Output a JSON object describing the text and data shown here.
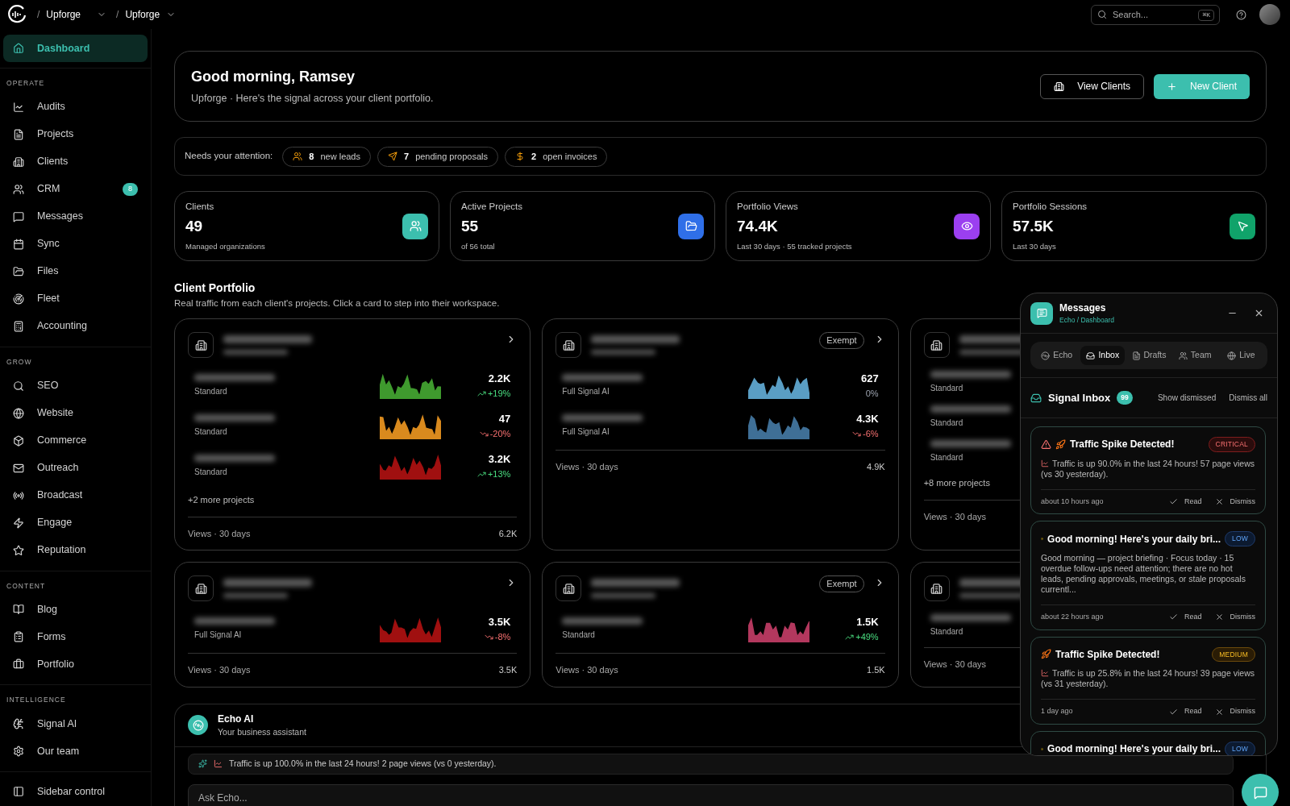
{
  "topbar": {
    "breadcrumbs": [
      {
        "separator": "/",
        "label": "Upforge"
      },
      {
        "separator": "/",
        "label": "Upforge"
      }
    ],
    "search": {
      "placeholder": "Search...",
      "shortcut": "⌘K"
    }
  },
  "sidebar": {
    "home": {
      "label": "Dashboard",
      "selected": true
    },
    "sections": [
      {
        "title": "OPERATE",
        "items": [
          {
            "label": "Audits",
            "selected": false
          },
          {
            "label": "Projects",
            "selected": false
          },
          {
            "label": "Clients",
            "selected": false
          },
          {
            "label": "CRM",
            "selected": false,
            "badge": "8"
          },
          {
            "label": "Messages",
            "selected": false
          },
          {
            "label": "Sync",
            "selected": false
          },
          {
            "label": "Files",
            "selected": false
          },
          {
            "label": "Fleet",
            "selected": false
          },
          {
            "label": "Accounting",
            "selected": false
          }
        ]
      },
      {
        "title": "GROW",
        "items": [
          {
            "label": "SEO",
            "selected": false
          },
          {
            "label": "Website",
            "selected": false
          },
          {
            "label": "Commerce",
            "selected": false
          },
          {
            "label": "Outreach",
            "selected": false
          },
          {
            "label": "Broadcast",
            "selected": false
          },
          {
            "label": "Engage",
            "selected": false
          },
          {
            "label": "Reputation",
            "selected": false
          }
        ]
      },
      {
        "title": "CONTENT",
        "items": [
          {
            "label": "Blog",
            "selected": false
          },
          {
            "label": "Forms",
            "selected": false
          },
          {
            "label": "Portfolio",
            "selected": false
          }
        ]
      },
      {
        "title": "INTELLIGENCE",
        "items": [
          {
            "label": "Signal AI",
            "selected": false
          },
          {
            "label": "Our team",
            "selected": false
          }
        ]
      }
    ],
    "footer": {
      "label": "Sidebar control"
    }
  },
  "header": {
    "title": "Good morning, Ramsey",
    "subtitle": "Upforge · Here's the signal across your client portfolio.",
    "buttons": [
      {
        "label": "View Clients",
        "kind": "secondary"
      },
      {
        "label": "New Client",
        "kind": "primary"
      }
    ]
  },
  "attention": {
    "label": "Needs your attention:",
    "chips": [
      {
        "count": "8",
        "label": "new leads"
      },
      {
        "count": "7",
        "label": "pending proposals"
      },
      {
        "count": "2",
        "label": "open invoices"
      }
    ]
  },
  "stats": [
    {
      "label": "Clients",
      "value": "49",
      "note": "Managed organizations",
      "color": "#3cbfae"
    },
    {
      "label": "Active Projects",
      "value": "55",
      "note": "of 56 total",
      "color": "#2f6fe8"
    },
    {
      "label": "Portfolio Views",
      "value": "74.4K",
      "note": "Last 30 days · 55 tracked projects",
      "color": "#9b3ff0"
    },
    {
      "label": "Portfolio Sessions",
      "value": "57.5K",
      "note": "Last 30 days",
      "color": "#10a36a"
    }
  ],
  "portfolio": {
    "title": "Client Portfolio",
    "subtitle": "Real traffic from each client's projects. Click a card to step into their workspace.",
    "cards": [
      {
        "chevron": true,
        "projects": [
          {
            "plan": "Standard",
            "value": "2.2K",
            "change": "+19%",
            "kind": "up",
            "color": "#3f9a2e"
          },
          {
            "plan": "Standard",
            "value": "47",
            "change": "-20%",
            "kind": "down",
            "color": "#d98a1e"
          },
          {
            "plan": "Standard",
            "value": "3.2K",
            "change": "+13%",
            "kind": "up",
            "color": "#a01010"
          }
        ],
        "more": "+2 more projects",
        "footer_label": "Views · 30 days",
        "footer_total": "6.2K"
      },
      {
        "chevron": true,
        "badge": "Exempt",
        "projects": [
          {
            "plan": "Full Signal AI",
            "value": "627",
            "change": "0%",
            "kind": "flat",
            "color": "#5a9ec4"
          },
          {
            "plan": "Full Signal AI",
            "value": "4.3K",
            "change": "-6%",
            "kind": "down",
            "color": "#3f6f96"
          }
        ],
        "footer_label": "Views · 30 days",
        "footer_total": "4.9K"
      },
      {
        "chevron": false,
        "projects": [
          {
            "plan": "Standard"
          },
          {
            "plan": "Standard"
          },
          {
            "plan": "Standard"
          }
        ],
        "more": "+8 more projects",
        "footer_label": "Views · 30 days"
      },
      {
        "chevron": true,
        "projects": [
          {
            "plan": "Full Signal AI",
            "value": "3.5K",
            "change": "-8%",
            "kind": "down",
            "color": "#a01010"
          }
        ],
        "footer_label": "Views · 30 days",
        "footer_total": "3.5K"
      },
      {
        "chevron": true,
        "badge": "Exempt",
        "projects": [
          {
            "plan": "Standard",
            "value": "1.5K",
            "change": "+49%",
            "kind": "up",
            "color": "#b3385e"
          }
        ],
        "footer_label": "Views · 30 days",
        "footer_total": "1.5K"
      },
      {
        "chevron": false,
        "projects": [
          {
            "plan": "Standard"
          }
        ],
        "footer_label": "Views · 30 days"
      }
    ]
  },
  "echo": {
    "title": "Echo AI",
    "subtitle": "Your business assistant",
    "message": "Traffic is up 100.0% in the last 24 hours! 2 page views (vs 0 yesterday).",
    "input": {
      "placeholder": "Ask Echo..."
    }
  },
  "messages_panel": {
    "title": "Messages",
    "breadcrumb": "Echo / Dashboard",
    "tabs": [
      {
        "label": "Echo",
        "selected": false
      },
      {
        "label": "Inbox",
        "selected": true
      },
      {
        "label": "Drafts",
        "selected": false
      },
      {
        "label": "Team",
        "selected": false
      },
      {
        "label": "Live",
        "selected": false
      }
    ],
    "inbox": {
      "title": "Signal Inbox",
      "count": "99",
      "actions": [
        "Show dismissed",
        "Dismiss all"
      ]
    },
    "notifications": [
      {
        "kind": "traffic",
        "alert": true,
        "title": "Traffic Spike Detected!",
        "badge": {
          "kind": "critical",
          "label": "CRITICAL"
        },
        "body": "Traffic is up 90.0% in the last 24 hours! 57 page views (vs 30 yesterday).",
        "time": "about 10 hours ago",
        "read_label": "Read",
        "dismiss_label": "Dismiss"
      },
      {
        "kind": "briefing",
        "alert": false,
        "title": "Good morning! Here's your daily bri...",
        "badge": {
          "kind": "low",
          "label": "LOW"
        },
        "body": "Good morning — project briefing · Focus today · 15 overdue follow-ups need attention; there are no hot leads, pending approvals, meetings, or stale proposals currentl...",
        "time": "about 22 hours ago",
        "read_label": "Read",
        "dismiss_label": "Dismiss"
      },
      {
        "kind": "traffic",
        "alert": false,
        "title": "Traffic Spike Detected!",
        "badge": {
          "kind": "medium",
          "label": "MEDIUM"
        },
        "body": "Traffic is up 25.8% in the last 24 hours! 39 page views (vs 31 yesterday).",
        "time": "1 day ago",
        "read_label": "Read",
        "dismiss_label": "Dismiss"
      },
      {
        "kind": "briefing",
        "alert": false,
        "title": "Good morning! Here's your daily bri...",
        "badge": {
          "kind": "low",
          "label": "LOW"
        }
      }
    ]
  }
}
